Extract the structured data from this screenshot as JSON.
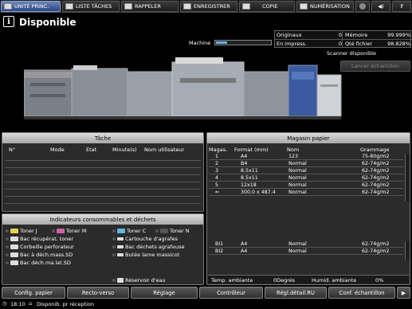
{
  "tabs": [
    {
      "label": "UNITÉ PRINC.",
      "active": true,
      "icon": "main-unit-icon"
    },
    {
      "label": "LISTE TÂCHES",
      "active": false,
      "icon": "job-list-icon"
    },
    {
      "label": "RAPPELER",
      "active": false,
      "icon": "recall-icon"
    },
    {
      "label": "ENREGISTRER",
      "active": false,
      "icon": "store-icon"
    },
    {
      "label": "COPIE",
      "active": false,
      "icon": "copy-icon"
    },
    {
      "label": "NUMÉRISATION",
      "active": false,
      "icon": "scan-icon"
    }
  ],
  "header": {
    "title": "Disponible",
    "info_glyph": "i"
  },
  "counters": {
    "originaux_label": "Originaux",
    "originaux_value": "0",
    "memoire_label": "Mémoire",
    "memoire_value": "99.999%",
    "en_impress_label": "En impress.",
    "en_impress_value": "0",
    "qte_fichier_label": "Qté fichier",
    "qte_fichier_value": "98.828%"
  },
  "machine": {
    "label": "Machine",
    "progress": 0.2
  },
  "scanner": {
    "status": "Scanner disponible",
    "sample_button": "Lancer échantillon"
  },
  "tache": {
    "title": "Tâche",
    "columns": [
      "N°",
      "Mode",
      "Etat",
      "Minute(s)",
      "Nom utilisateur"
    ]
  },
  "magasin": {
    "title": "Magasin papier",
    "columns": [
      "Magas.",
      "Format (mm)",
      "Nom",
      "Grammage"
    ],
    "rows": [
      {
        "mag": "1",
        "format": "A4",
        "nom": "123",
        "grammage": "75-80g/m2"
      },
      {
        "mag": "2",
        "format": "B4",
        "nom": "Normal",
        "grammage": "62-74g/m2"
      },
      {
        "mag": "3",
        "format": "8.5x11",
        "nom": "Normal",
        "grammage": "62-74g/m2"
      },
      {
        "mag": "4",
        "format": "8.5x11",
        "nom": "Normal",
        "grammage": "62-74g/m2"
      },
      {
        "mag": "5",
        "format": "12x18",
        "nom": "Normal",
        "grammage": "62-74g/m2"
      },
      {
        "mag": "⇐",
        "format": "300.0 x 487.4",
        "nom": "Normal",
        "grammage": "62-74g/m2"
      },
      {
        "mag": "BI1",
        "format": "A4",
        "nom": "Normal",
        "grammage": "62-74g/m2"
      },
      {
        "mag": "BI2",
        "format": "A4",
        "nom": "Normal",
        "grammage": "62-74g/m2"
      }
    ]
  },
  "consommables": {
    "title": "Indicateurs consommables et déchets",
    "toners": [
      "Toner J",
      "Toner M",
      "Toner C",
      "Toner N"
    ],
    "left_items": [
      "Bac récupérat. toner",
      "Corbeille perforateur",
      "Bac à déch.mass.SD",
      "Bac déch.ma.lat.SD"
    ],
    "right_items": [
      "Cartouche d'agrafes",
      "Bac déchets agrafeuse",
      "Butée lame massicot"
    ],
    "reservoir": "Réservoir d'eau"
  },
  "environment": {
    "temp_label": "Temp. ambiante",
    "temp_value": "0Degrés",
    "humid_label": "Humid. ambiante",
    "humid_value": "0%"
  },
  "bottom_buttons": [
    "Config. papier",
    "Recto-verso",
    "Réglage",
    "Contrôleur",
    "Régl.détail.RU",
    "Conf. échantillon"
  ],
  "status": {
    "time": "18:10",
    "message": "Disponib. pr réception"
  }
}
